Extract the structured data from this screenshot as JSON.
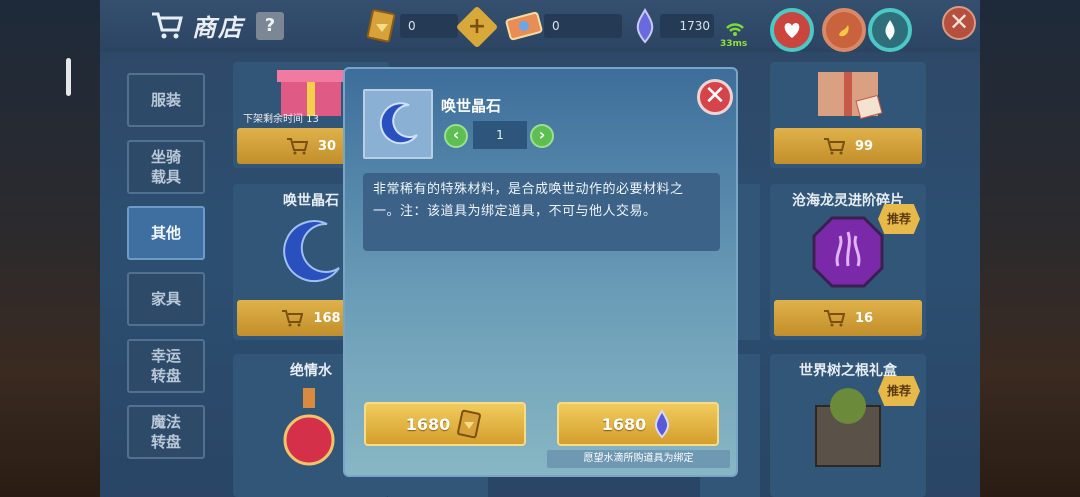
{
  "header": {
    "title": "商店",
    "help_label": "?",
    "gold_value": "0",
    "ticket_value": "0",
    "water_value": "1730",
    "ping": "33ms",
    "close_label": "✕"
  },
  "tabs": [
    {
      "label": "服装"
    },
    {
      "label": "坐骑\n载具"
    },
    {
      "label": "其他",
      "active": true
    },
    {
      "label": "家具"
    },
    {
      "label": "幸运\n转盘"
    },
    {
      "label": "魔法\n转盘"
    }
  ],
  "shop_items": {
    "gift_box_left": {
      "timer": "下架剩余时间 13",
      "price": "30"
    },
    "crystal_stone": {
      "name": "唤世晶石",
      "price": "168"
    },
    "love_potion": {
      "name": "绝情水"
    },
    "gift_box_right": {
      "price": "99"
    },
    "dragon_fragment": {
      "name": "沧海龙灵进阶碎片",
      "price": "16",
      "badge": "推荐"
    },
    "world_tree_gift": {
      "name": "世界树之根礼盒",
      "badge": "推荐"
    }
  },
  "modal": {
    "item_name": "唤世晶石",
    "quantity": "1",
    "qty_dec": "‹",
    "qty_inc": "›",
    "close_label": "✕",
    "description": "非常稀有的特殊材料，是合成唤世动作的必要材料之一。注：该道具为绑定道具，不可与他人交易。",
    "buy_gold_price": "1680",
    "buy_water_price": "1680",
    "note": "愿望水滴所购道具为绑定"
  },
  "colors": {
    "accent_gold": "#d8a83a",
    "modal_close": "#d5434b",
    "stepper_green": "#5dbf52"
  }
}
